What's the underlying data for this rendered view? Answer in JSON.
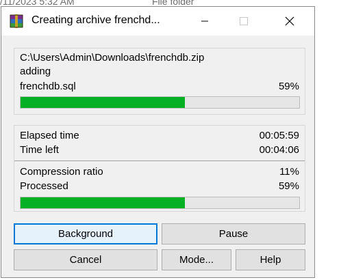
{
  "background": {
    "date_text": "/11/2023 5:32 AM",
    "type_text": "File folder"
  },
  "window": {
    "title": "Creating archive frenchd...",
    "icon": "winrar-archive-icon"
  },
  "file_panel": {
    "archive_path": "C:\\Users\\Admin\\Downloads\\frenchdb.zip",
    "operation": "adding",
    "current_file": "frenchdb.sql",
    "current_percent": "59%",
    "current_progress": 0.59
  },
  "stats_panel": {
    "elapsed_label": "Elapsed time",
    "elapsed_value": "00:05:59",
    "time_left_label": "Time left",
    "time_left_value": "00:04:06",
    "ratio_label": "Compression ratio",
    "ratio_value": "11%",
    "processed_label": "Processed",
    "processed_value": "59%",
    "total_progress": 0.59
  },
  "buttons": {
    "background": "Background",
    "pause": "Pause",
    "cancel": "Cancel",
    "mode": "Mode...",
    "help": "Help"
  },
  "colors": {
    "progress_fill": "#06b025",
    "focus_border": "#0078d7"
  }
}
